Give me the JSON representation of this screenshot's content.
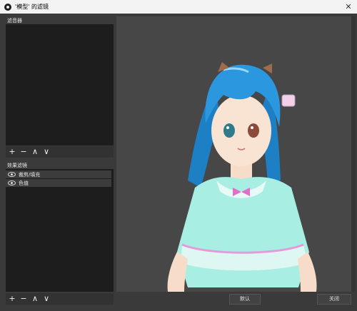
{
  "window": {
    "title": "'模型' 的滤镜",
    "close_glyph": "✕"
  },
  "left": {
    "audio_filters_label": "滤音器",
    "effect_filters_label": "效果滤镜",
    "effect_filters": [
      {
        "label": "裁剪/填充",
        "visible": true
      },
      {
        "label": "色值",
        "visible": true
      }
    ],
    "toolbar_glyphs": {
      "add": "+",
      "remove": "−",
      "up": "∧",
      "down": "∨"
    }
  },
  "buttons": {
    "defaults": "默认",
    "close": "关闭"
  },
  "preview": {
    "description_icon": "anime-girl-model"
  }
}
